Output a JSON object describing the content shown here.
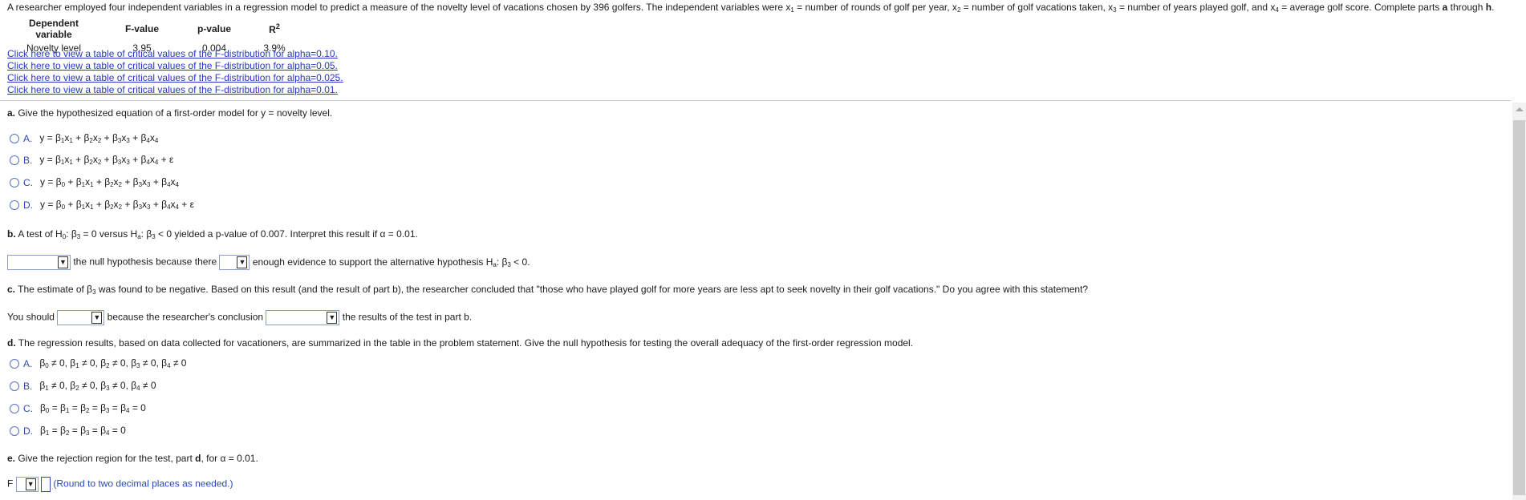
{
  "problem": {
    "intro_pre": "A researcher employed four independent variables in a regression model to predict a measure of the novelty level of vacations chosen by 396 golfers. The independent variables were x",
    "intro_x1_def": " = number of rounds of golf per year, x",
    "intro_x2_def": " = number of golf vacations taken, x",
    "intro_x3_def": " = number of years played golf, and x",
    "intro_x4_def": " = average golf score. Complete parts ",
    "intro_parts_a": "a",
    "intro_through": " through ",
    "intro_parts_h": "h",
    "intro_end": "."
  },
  "results_table": {
    "headers": [
      "Dependent variable",
      "F-value",
      "p-value",
      "R"
    ],
    "r_sup": "2",
    "row": [
      "Novelty level",
      "3.95",
      "0.004",
      "3.9%"
    ]
  },
  "links": [
    "Click here to view a table of critical values of the F-distribution for alpha=0.10.",
    "Click here to view a table of critical values of the F-distribution for alpha=0.05.",
    "Click here to view a table of critical values of the F-distribution for alpha=0.025.",
    "Click here to view a table of critical values of the F-distribution for alpha=0.01."
  ],
  "part_a": {
    "label": "a.",
    "question": " Give the hypothesized equation of a first-order model for y = novelty level.",
    "options": [
      {
        "letter": "A.",
        "text": "y = β1x1 + β2x2 + β3x3 + β4x4"
      },
      {
        "letter": "B.",
        "text": "y = β1x1 + β2x2 + β3x3 + β4x4 + ε"
      },
      {
        "letter": "C.",
        "text": "y = β0 + β1x1 + β2x2 + β3x3 + β4x4"
      },
      {
        "letter": "D.",
        "text": "y = β0 + β1x1 + β2x2 + β3x3 + β4x4 + ε"
      }
    ]
  },
  "part_b": {
    "label": "b.",
    "question": " A test of H0: β3 = 0 versus Ha: β3 < 0 yielded a p-value of 0.007. Interpret this result if α = 0.01.",
    "answer_mid": "the null hypothesis because there",
    "answer_end": "enough evidence to support the alternative hypothesis Ha: β3 < 0."
  },
  "part_c": {
    "label": "c.",
    "question": " The estimate of β3 was found to be negative. Based on this result (and the result of part b), the researcher concluded that \"those who have played golf for more years are less apt to seek novelty in their golf vacations.\" Do you agree with this statement?",
    "answer_start": "You should",
    "answer_mid": "because the researcher's conclusion",
    "answer_end": "the results of the test in part b."
  },
  "part_d": {
    "label": "d.",
    "question": " The regression results, based on data collected for vacationers, are summarized in the table in the problem statement. Give the null hypothesis for testing the overall adequacy of the first-order regression model.",
    "options": [
      {
        "letter": "A.",
        "text": "β0 ≠ 0, β1 ≠ 0, β2 ≠ 0, β3 ≠ 0, β4 ≠ 0"
      },
      {
        "letter": "B.",
        "text": "β1 ≠ 0, β2 ≠ 0, β3 ≠ 0, β4 ≠ 0"
      },
      {
        "letter": "C.",
        "text": "β0 = β1 = β2 = β3 = β4 = 0"
      },
      {
        "letter": "D.",
        "text": "β1 = β2 = β3 = β4 = 0"
      }
    ]
  },
  "part_e": {
    "label": "e.",
    "question": " Give the rejection region for the test, part ",
    "question_d": "d",
    "question_end": ", for α = 0.01.",
    "var": "F",
    "hint": "(Round to two decimal places as needed.)"
  }
}
